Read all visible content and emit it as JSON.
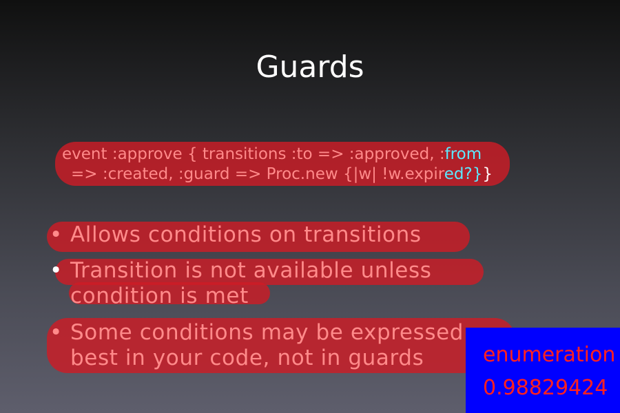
{
  "slide": {
    "title": "Guards",
    "code_line1_main": "event :approve { transitions :to => :approved, :",
    "code_line1_tail": "from",
    "code_line2_main": "=> :created, :guard => Proc.new {|w| !w.expir",
    "code_line2_tail": "ed?}",
    "code_line2_end": "}",
    "bullet_char": "•",
    "bullets": [
      {
        "line1": "Allows conditions on transitions"
      },
      {
        "line1": "Transition is not available unless",
        "line2": "condition is met"
      },
      {
        "line1": "Some conditions may be expressed",
        "line2": "best in your code, not in guards"
      }
    ]
  },
  "annotation": {
    "label": "enumeration",
    "score": "0.98829424",
    "box_color": "#0000ff",
    "text_color": "#ff2020",
    "highlight_color": "#cd1c26"
  }
}
